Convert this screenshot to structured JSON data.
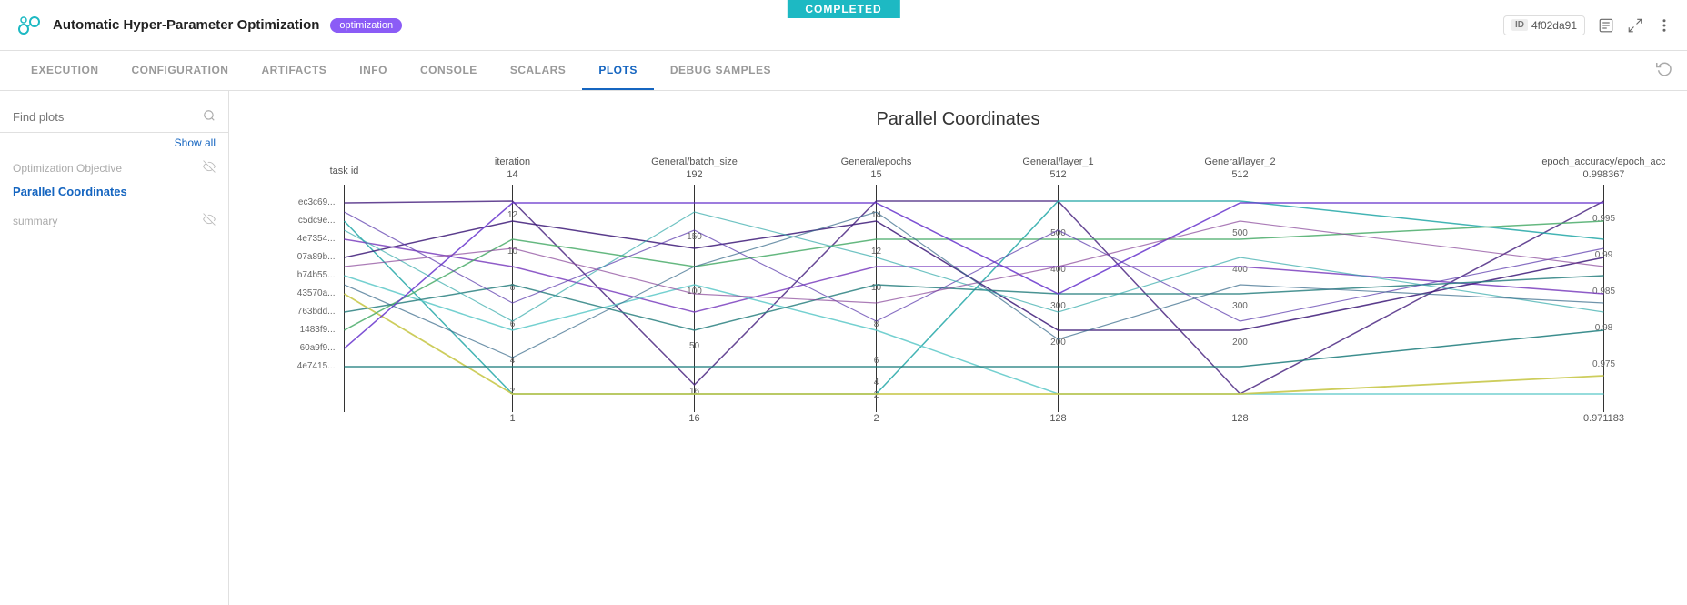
{
  "completed_badge": "COMPLETED",
  "app": {
    "title": "Automatic Hyper-Parameter Optimization",
    "tag": "optimization",
    "id": "4f02da91"
  },
  "tabs": [
    {
      "label": "EXECUTION",
      "active": false
    },
    {
      "label": "CONFIGURATION",
      "active": false
    },
    {
      "label": "ARTIFACTS",
      "active": false
    },
    {
      "label": "INFO",
      "active": false
    },
    {
      "label": "CONSOLE",
      "active": false
    },
    {
      "label": "SCALARS",
      "active": false
    },
    {
      "label": "PLOTS",
      "active": true
    },
    {
      "label": "DEBUG SAMPLES",
      "active": false
    }
  ],
  "sidebar": {
    "search_placeholder": "Find plots",
    "show_all": "Show all",
    "sections": [
      {
        "title": "Optimization Objective",
        "items": []
      },
      {
        "title": "Parallel Coordinates",
        "items": [
          "Parallel Coordinates"
        ],
        "active": true
      },
      {
        "title": "summary",
        "items": []
      }
    ]
  },
  "chart": {
    "title": "Parallel Coordinates",
    "axes": [
      {
        "label": "task id",
        "top_val": "",
        "bottom_val": ""
      },
      {
        "label": "iteration",
        "top_val": "14",
        "bottom_val": "1"
      },
      {
        "label": "General/batch_size",
        "top_val": "192",
        "bottom_val": "16"
      },
      {
        "label": "General/epochs",
        "top_val": "15",
        "bottom_val": "2"
      },
      {
        "label": "General/layer_1",
        "top_val": "512",
        "bottom_val": "128"
      },
      {
        "label": "General/layer_2",
        "top_val": "512",
        "bottom_val": "128"
      },
      {
        "label": "epoch_accuracy/epoch_acc",
        "top_val": "0.998367",
        "bottom_val": "0.971183"
      }
    ],
    "task_ids": [
      "ec3c69...",
      "c5dc9e...",
      "4e7354...",
      "07a89b...",
      "b74b55...",
      "43570a...",
      "763bdd...",
      "1483f9...",
      "60a9f9...",
      "4e7415..."
    ]
  }
}
